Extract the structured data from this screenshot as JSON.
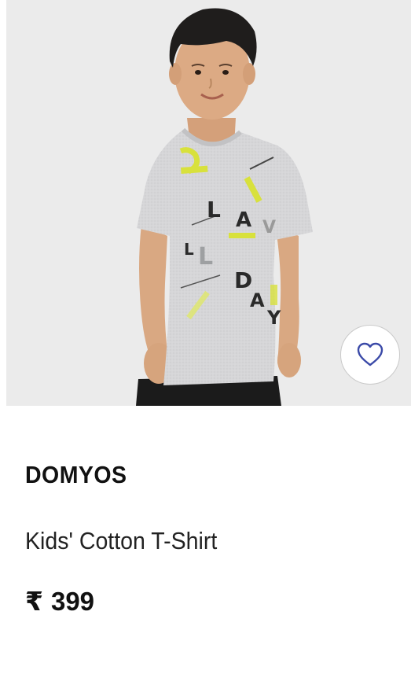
{
  "product": {
    "brand": "DOMYOS",
    "name": "Kids' Cotton T-Shirt",
    "currency_symbol": "₹",
    "price": "399",
    "image_background_color": "#ebebeb",
    "wishlist_icon": "heart-outline-icon",
    "wishlist_icon_color": "#3b4aa8"
  },
  "tshirt_print": {
    "letters": [
      "L",
      "A",
      "V",
      "L",
      "L",
      "D",
      "A",
      "Y"
    ]
  }
}
